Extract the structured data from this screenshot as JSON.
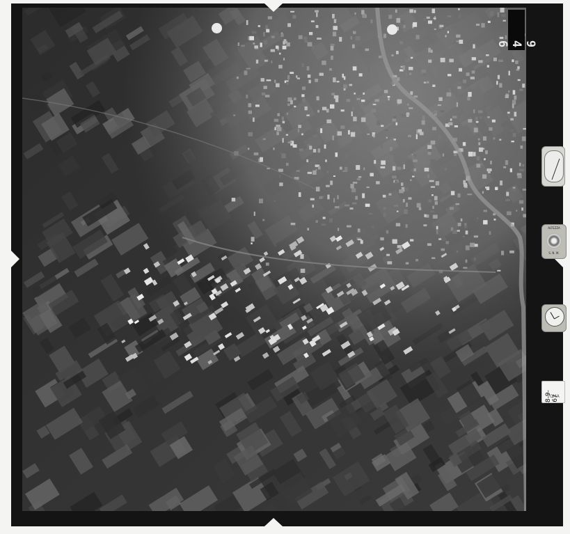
{
  "image": {
    "subject": "Aerial reconnaissance photograph",
    "frame_number": "9 4 6",
    "date_label": "18-9-67",
    "date_sub": "TOMA"
  },
  "instruments": {
    "level_text_top": "ALTEZZA",
    "level_text_bottom": "S. N. M."
  },
  "colors": {
    "frame": "#141414",
    "paper": "#f4f4f2",
    "river": "#9a9a9a"
  }
}
